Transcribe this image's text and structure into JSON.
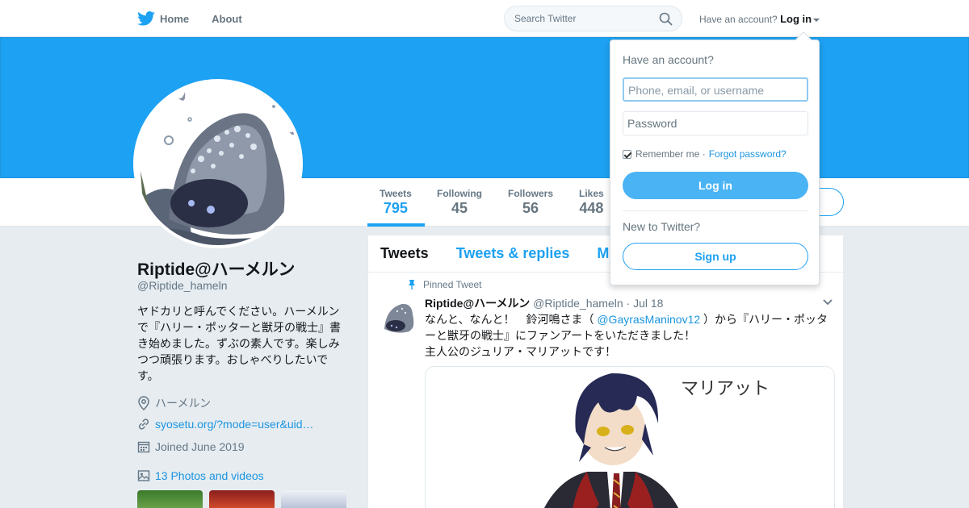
{
  "nav": {
    "home_label": "Home",
    "about_label": "About",
    "search_placeholder": "Search Twitter",
    "have_account": "Have an account?",
    "login_label": "Log in"
  },
  "profile": {
    "name": "Riptide@ハーメルン",
    "handle": "@Riptide_hameln",
    "bio": "ヤドカリと呼んでください。ハーメルンで『ハリー・ポッターと獣牙の戦士』書き始めました。ずぶの素人です。楽しみつつ頑張ります。おしゃべりしたいです。",
    "location": "ハーメルン",
    "url": "syosetu.org/?mode=user&uid…",
    "joined": "Joined June 2019",
    "photos_label": "13 Photos and videos",
    "stats": [
      {
        "label": "Tweets",
        "value": "795"
      },
      {
        "label": "Following",
        "value": "45"
      },
      {
        "label": "Followers",
        "value": "56"
      },
      {
        "label": "Likes",
        "value": "448"
      }
    ]
  },
  "timeline": {
    "tabs": [
      "Tweets",
      "Tweets & replies",
      "M"
    ],
    "tweet": {
      "pinned_label": "Pinned Tweet",
      "author_name": "Riptide@ハーメルン",
      "author_handle": "@Riptide_hameln",
      "date": "· Jul 18",
      "text_before": "なんと、なんと！　鈴河鳴さま（ ",
      "mention": "@GayrasManinov12",
      "text_after": " ）から『ハリー・ポッターと獣牙の戦士』にファンアートをいただきました！",
      "text_line2": "主人公のジュリア・マリアットです！",
      "image_caption": "マリアット"
    }
  },
  "login_dropdown": {
    "title": "Have an account?",
    "username_placeholder": "Phone, email, or username",
    "password_placeholder": "Password",
    "remember_label": "Remember me ·",
    "forgot_label": "Forgot password?",
    "login_button": "Log in",
    "new_label": "New to Twitter?",
    "signup_button": "Sign up"
  },
  "colors": {
    "brand": "#1da1f2",
    "banner": "#1da1f2",
    "background": "#e6ecf0"
  },
  "icons": [
    "twitter-bird-icon",
    "home-icon",
    "search-icon",
    "location-icon",
    "link-icon",
    "calendar-icon",
    "photo-icon",
    "pin-icon",
    "chevron-down-icon"
  ]
}
